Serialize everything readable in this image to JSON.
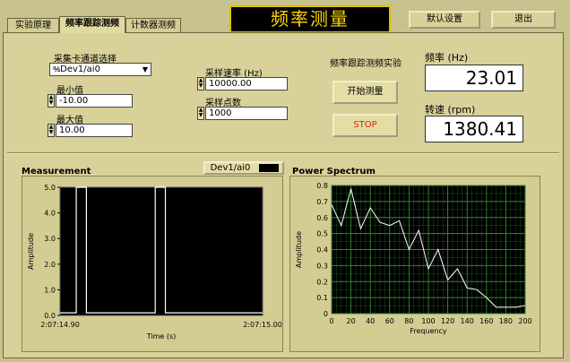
{
  "tabs": [
    {
      "label": "实验原理",
      "active": false
    },
    {
      "label": "频率跟踪测频",
      "active": true
    },
    {
      "label": "计数器测频",
      "active": false
    }
  ],
  "title": "频率测量",
  "buttons": {
    "defaults": "默认设置",
    "exit": "退出",
    "start": "开始测量",
    "stop": "STOP"
  },
  "channel": {
    "label": "采集卡通道选择",
    "value": "Dev1/ai0",
    "prefix": "℁"
  },
  "min": {
    "label": "最小值",
    "value": "-10.00"
  },
  "max": {
    "label": "最大值",
    "value": "10.00"
  },
  "rate": {
    "label": "采样速率 (Hz)",
    "value": "10000.00"
  },
  "points": {
    "label": "采样点数",
    "value": "1000"
  },
  "experiment_label": "频率跟踪测频实验",
  "frequency": {
    "label": "频率 (Hz)",
    "value": "23.01"
  },
  "speed": {
    "label": "转速 (rpm)",
    "value": "1380.41"
  },
  "legend_label": "Dev1/ai0",
  "colors": {
    "background": "#c8c28e",
    "panel": "#d8d19a",
    "title_text": "#ffd800",
    "stop_text": "#e02000",
    "plot_bg": "#000000",
    "waveform": "#ffffff",
    "grid": "#2e8b2e"
  },
  "chart_data": [
    {
      "type": "line",
      "title": "Measurement",
      "xlabel": "Time (s)",
      "ylabel": "Amplitude",
      "x_tick_labels": [
        "2:07:14.90",
        "2:07:15.00"
      ],
      "y_ticks": [
        "0.0",
        "1.0",
        "2.0",
        "3.0",
        "4.0",
        "5.0"
      ],
      "ylim": [
        0,
        5
      ],
      "grid": false,
      "series": [
        {
          "name": "Dev1/ai0",
          "x": [
            0,
            0.08,
            0.08,
            0.13,
            0.13,
            0.47,
            0.47,
            0.52,
            0.52,
            1.0
          ],
          "y": [
            0.1,
            0.1,
            5.0,
            5.0,
            0.1,
            0.1,
            5.0,
            5.0,
            0.1,
            0.1
          ]
        }
      ]
    },
    {
      "type": "line",
      "title": "Power Spectrum",
      "xlabel": "Frequency",
      "ylabel": "Amplitude",
      "x_ticks": [
        0,
        20,
        40,
        60,
        80,
        100,
        120,
        140,
        160,
        180,
        200
      ],
      "y_ticks": [
        "0",
        "0.1",
        "0.2",
        "0.3",
        "0.4",
        "0.5",
        "0.6",
        "0.7",
        "0.8"
      ],
      "xlim": [
        0,
        200
      ],
      "ylim": [
        0,
        0.8
      ],
      "grid": true,
      "series": [
        {
          "name": "",
          "x": [
            0,
            10,
            20,
            30,
            40,
            50,
            60,
            70,
            80,
            90,
            100,
            110,
            120,
            130,
            140,
            150,
            160,
            170,
            180,
            190,
            200
          ],
          "y": [
            0.68,
            0.55,
            0.78,
            0.53,
            0.66,
            0.57,
            0.55,
            0.58,
            0.4,
            0.52,
            0.28,
            0.4,
            0.21,
            0.28,
            0.16,
            0.15,
            0.1,
            0.04,
            0.04,
            0.04,
            0.05
          ]
        }
      ]
    }
  ]
}
